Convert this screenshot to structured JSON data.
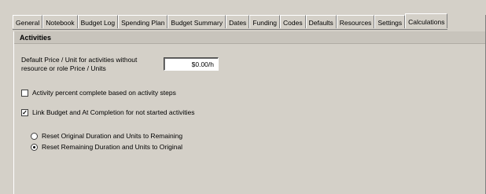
{
  "tabs": [
    {
      "label": "General",
      "active": false
    },
    {
      "label": "Notebook",
      "active": false
    },
    {
      "label": "Budget Log",
      "active": false
    },
    {
      "label": "Spending Plan",
      "active": false
    },
    {
      "label": "Budget Summary",
      "active": false
    },
    {
      "label": "Dates",
      "active": false
    },
    {
      "label": "Funding",
      "active": false
    },
    {
      "label": "Codes",
      "active": false
    },
    {
      "label": "Defaults",
      "active": false
    },
    {
      "label": "Resources",
      "active": false
    },
    {
      "label": "Settings",
      "active": false
    },
    {
      "label": "Calculations",
      "active": true
    }
  ],
  "section": {
    "title": "Activities"
  },
  "price_field": {
    "label": "Default Price / Unit for activities without resource or role Price / Units",
    "value": "$0.00/h"
  },
  "options": {
    "percent_complete": {
      "label": "Activity percent complete based on activity steps",
      "checked": false
    },
    "link_budget": {
      "label": "Link Budget and At Completion for not started activities",
      "checked": true
    }
  },
  "reset": {
    "original_label": "Reset Original Duration and Units to Remaining",
    "original_selected": false,
    "remaining_label": "Reset Remaining Duration and Units to Original",
    "remaining_selected": true
  }
}
